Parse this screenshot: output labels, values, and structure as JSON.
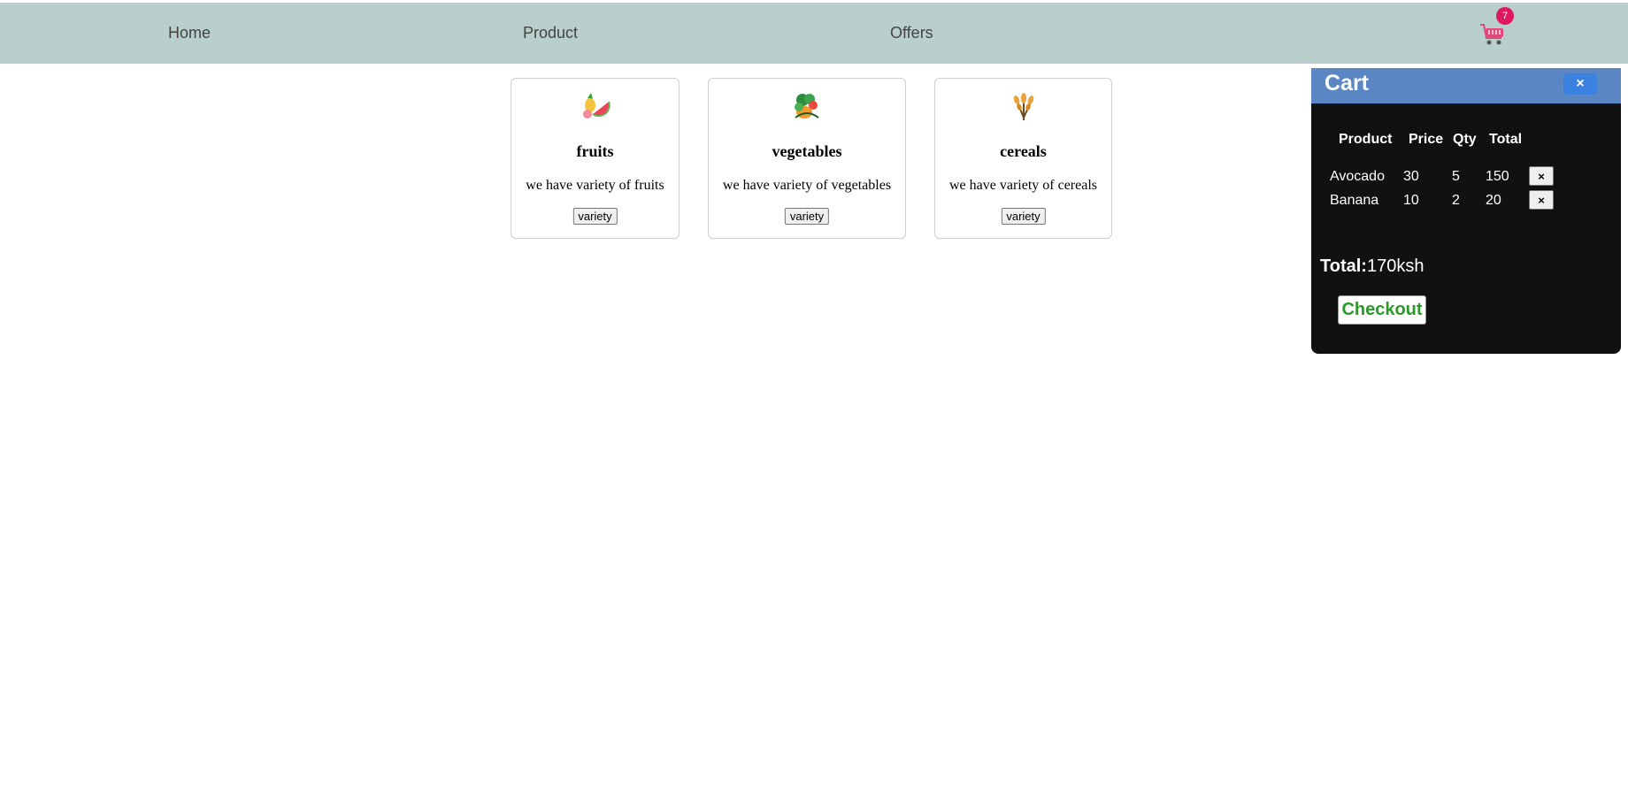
{
  "nav": {
    "home": "Home",
    "product": "Product",
    "offers": "Offers",
    "cart_count": "7",
    "cart_icon": "shopping-cart-icon",
    "badge_color": "#e0185e"
  },
  "categories": [
    {
      "title": "fruits",
      "description": "we have variety of fruits",
      "button": "variety",
      "icon": "fruits-icon"
    },
    {
      "title": "vegetables",
      "description": "we have variety of vegetables",
      "button": "variety",
      "icon": "vegetables-icon"
    },
    {
      "title": "cereals",
      "description": "we have variety of cereals",
      "button": "variety",
      "icon": "wheat-icon"
    }
  ],
  "cart": {
    "title": "Cart",
    "close_label": "×",
    "columns": [
      "Product",
      "Price",
      "Qty",
      "Total"
    ],
    "items": [
      {
        "product": "Avocado",
        "price": "30",
        "qty": "5",
        "total": "150",
        "remove_label": "×"
      },
      {
        "product": "Banana",
        "price": "10",
        "qty": "2",
        "total": "20",
        "remove_label": "×"
      }
    ],
    "total_label": "Total:",
    "total_value": "170ksh",
    "checkout_label": "Checkout",
    "header_color": "#5a86c4",
    "panel_color": "#111111",
    "checkout_color": "#2a9a2a"
  },
  "colors": {
    "navbar": "#b8cfcc"
  }
}
